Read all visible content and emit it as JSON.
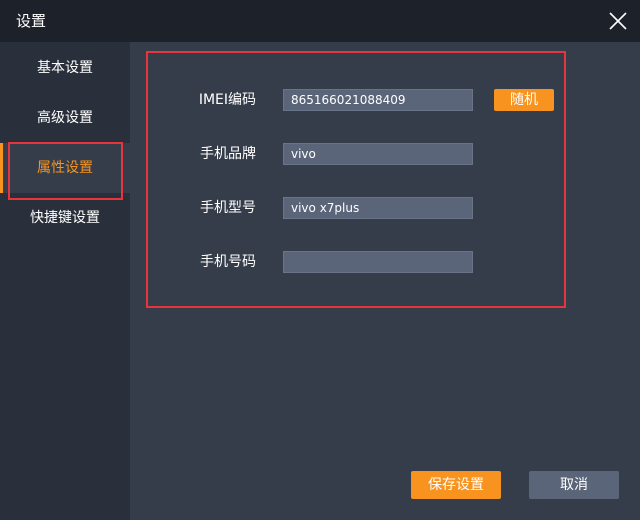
{
  "window": {
    "title": "设置",
    "close_icon": "close-icon"
  },
  "sidebar": {
    "items": [
      {
        "label": "基本设置",
        "active": false
      },
      {
        "label": "高级设置",
        "active": false
      },
      {
        "label": "属性设置",
        "active": true
      },
      {
        "label": "快捷键设置",
        "active": false
      }
    ]
  },
  "form": {
    "imei": {
      "label": "IMEI编码",
      "value": "865166021088409"
    },
    "brand": {
      "label": "手机品牌",
      "value": "vivo"
    },
    "model": {
      "label": "手机型号",
      "value": "vivo x7plus"
    },
    "phone": {
      "label": "手机号码",
      "value": ""
    },
    "random_label": "随机"
  },
  "footer": {
    "save_label": "保存设置",
    "cancel_label": "取消"
  },
  "colors": {
    "accent": "#f7931e",
    "annotation_red": "#e8343d",
    "titlebar_bg": "#1d2129",
    "sidebar_bg": "#2a303b",
    "content_bg": "#353d4a",
    "input_bg": "#5b6579"
  }
}
